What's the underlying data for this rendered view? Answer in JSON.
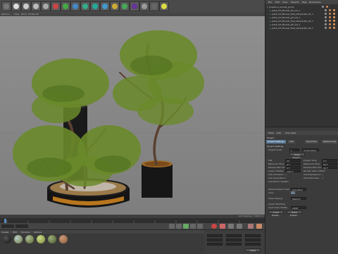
{
  "viewport_menu": [
    "Options",
    "View",
    "Panel",
    "ProRender"
  ],
  "status": {
    "grid_spacing": "Grid Spacing : 1000 cm"
  },
  "object_manager": {
    "menu": [
      "File",
      "Edit",
      "View",
      "Objects",
      "Tags",
      "Bookmarks"
    ],
    "objects": [
      "Juniperus_bonsai_group",
      "plant_ikh_Bonsai_pot_01_1",
      "plant_ikh_Bonsai_Tree_temperate_01_1",
      "plant_ikh_Bonsai_pot_02_1",
      "plant_ikh_Bonsai_Tree_temperate_02_1",
      "plant_ikh_Bonsai_pot_03_1",
      "plant_ikh_Bonsai_Tree_temperate_03_1"
    ]
  },
  "attributes": {
    "menu": [
      "Mode",
      "Edit",
      "User Data"
    ],
    "title": "Project",
    "tabs": [
      "Project Settings",
      "Info",
      "Dynamics",
      "Referencing"
    ],
    "section": "Project Settings",
    "project_scale_label": "Project Scale",
    "project_scale_value": "1",
    "project_scale_unit": "Centimeters",
    "scale_button": "Scale Project...",
    "left_fields": [
      {
        "label": "FPS",
        "value": "30"
      },
      {
        "label": "Minimum Time",
        "value": "0 F"
      },
      {
        "label": "Preview Min Time",
        "value": "0 F"
      },
      {
        "label": "Level of Detail",
        "value": "100 %"
      },
      {
        "label": "Use Animation",
        "value": "✓"
      },
      {
        "label": "Use Generators",
        "value": "✓"
      },
      {
        "label": "Use Motion System",
        "value": "✓"
      }
    ],
    "right_fields": [
      {
        "label": "Project Time",
        "value": "0 F"
      },
      {
        "label": "Maximum Time",
        "value": "90 F"
      },
      {
        "label": "Preview Max Time",
        "value": "90 F"
      },
      {
        "label": "Render LOD in Editor",
        "value": ""
      },
      {
        "label": "Use Expressions",
        "value": "✓"
      },
      {
        "label": "Use Deformers",
        "value": "✓"
      }
    ],
    "object_color_label": "Default Object Color",
    "object_color_value": "Gray-Blue",
    "color_label": "Color",
    "view_clipping_label": "View Clipping",
    "view_clipping_value": "Medium",
    "linear_workflow_label": "Linear Workflow",
    "input_color_label": "Input Color Profile",
    "input_color_value": "sRGB",
    "load_preset": "Load Preset...",
    "save_preset": "Save Preset..."
  },
  "materials": {
    "menu": [
      "Create",
      "Edit",
      "Function",
      "Texture"
    ],
    "swatches": [
      "#1a1a1a",
      "#6b7a3a",
      "#5a6a2a",
      "#7a8a3a",
      "#4a5a2a",
      "#8a5a3a"
    ]
  },
  "coords": {
    "apply_label": "Apply"
  },
  "colors": {
    "foliage": "#6a8a2a",
    "pot": "#1a1a1a",
    "soil": "#9a6a2a",
    "viewport_bg": "#8a8a8a"
  }
}
